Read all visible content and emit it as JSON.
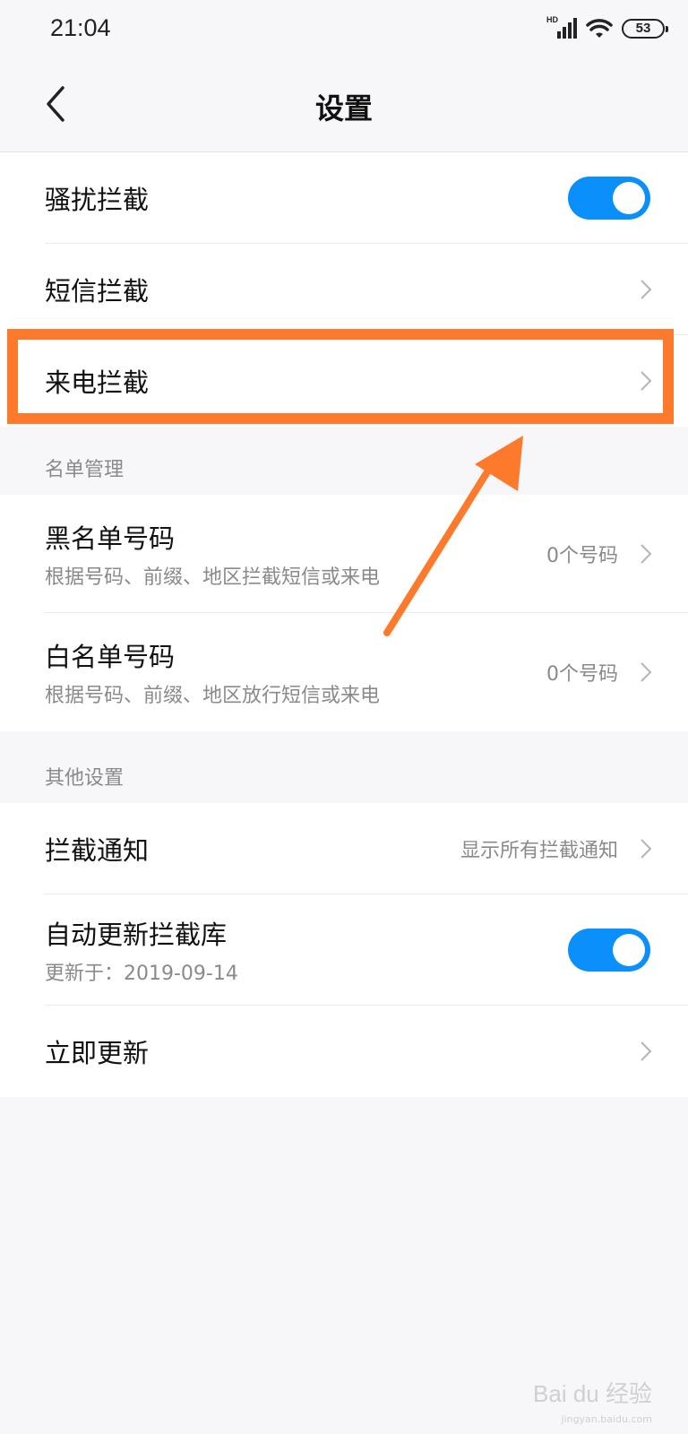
{
  "status_bar": {
    "time": "21:04",
    "network_type": "HD",
    "battery": "53"
  },
  "header": {
    "title": "设置"
  },
  "group1": {
    "items": [
      {
        "label": "骚扰拦截",
        "control": "toggle",
        "on": true
      },
      {
        "label": "短信拦截",
        "control": "chevron"
      },
      {
        "label": "来电拦截",
        "control": "chevron"
      }
    ]
  },
  "list_management": {
    "section_label": "名单管理",
    "items": [
      {
        "label": "黑名单号码",
        "subtitle": "根据号码、前缀、地区拦截短信或来电",
        "value": "0个号码"
      },
      {
        "label": "白名单号码",
        "subtitle": "根据号码、前缀、地区放行短信或来电",
        "value": "0个号码"
      }
    ]
  },
  "other_settings": {
    "section_label": "其他设置",
    "items": [
      {
        "label": "拦截通知",
        "value": "显示所有拦截通知",
        "control": "chevron"
      },
      {
        "label": "自动更新拦截库",
        "subtitle": "更新于：2019-09-14",
        "control": "toggle",
        "on": true
      },
      {
        "label": "立即更新",
        "control": "chevron"
      }
    ]
  },
  "annotation": {
    "highlight_color": "#fd7a2c"
  },
  "watermark": {
    "text": "Bai du 经验",
    "sub": "jingyan.baidu.com"
  },
  "colors": {
    "toggle_on": "#0b8ffb",
    "background": "#f7f7f9"
  }
}
